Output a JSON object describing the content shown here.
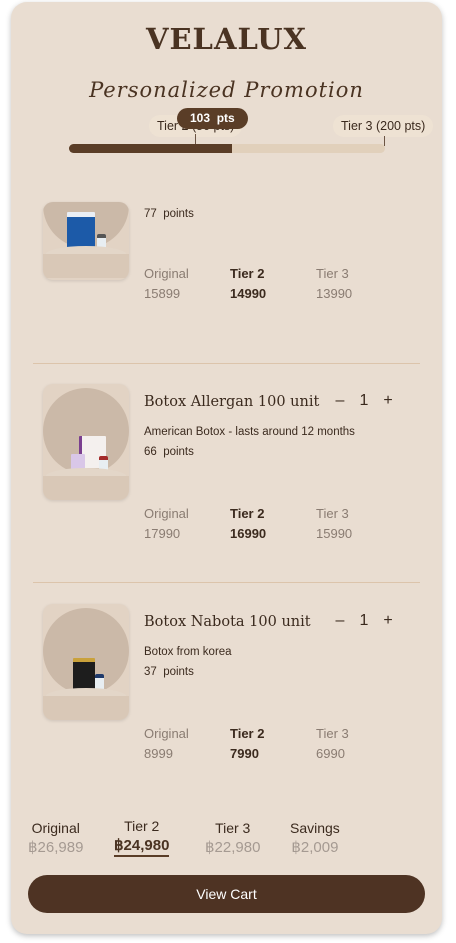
{
  "brand": "VELALUX",
  "subtitle": "Personalized Promotion",
  "progress": {
    "current_points": "103",
    "points_unit": "pts",
    "tier2_label": "Tier 2 (50 pts)",
    "tier3_label": "Tier 3 (200 pts)",
    "fill_fraction": 0.515
  },
  "col_labels": {
    "original": "Original",
    "tier2": "Tier 2",
    "tier3": "Tier 3"
  },
  "points_suffix": "points",
  "products": [
    {
      "name": "",
      "description": "",
      "points": "77",
      "original": "15899",
      "tier2": "14990",
      "tier3": "13990"
    },
    {
      "name": "Botox Allergan 100 unit",
      "description": "American Botox - lasts around 12 months",
      "points": "66",
      "quantity": "1",
      "minus": "–",
      "plus": "+",
      "original": "17990",
      "tier2": "16990",
      "tier3": "15990"
    },
    {
      "name": "Botox Nabota 100 unit",
      "description": "Botox from korea",
      "points": "37",
      "quantity": "1",
      "minus": "–",
      "plus": "+",
      "original": "8999",
      "tier2": "7990",
      "tier3": "6990"
    }
  ],
  "summary": {
    "original_label": "Original",
    "original_value": "฿26,989",
    "tier2_label": "Tier 2",
    "tier2_value": "฿24,980",
    "tier3_label": "Tier 3",
    "tier3_value": "฿22,980",
    "savings_label": "Savings",
    "savings_value": "฿2,009"
  },
  "view_cart": "View Cart",
  "colors": {
    "background": "#e9ddd1",
    "accent": "#5a3d27",
    "muted": "#8a7c72"
  }
}
